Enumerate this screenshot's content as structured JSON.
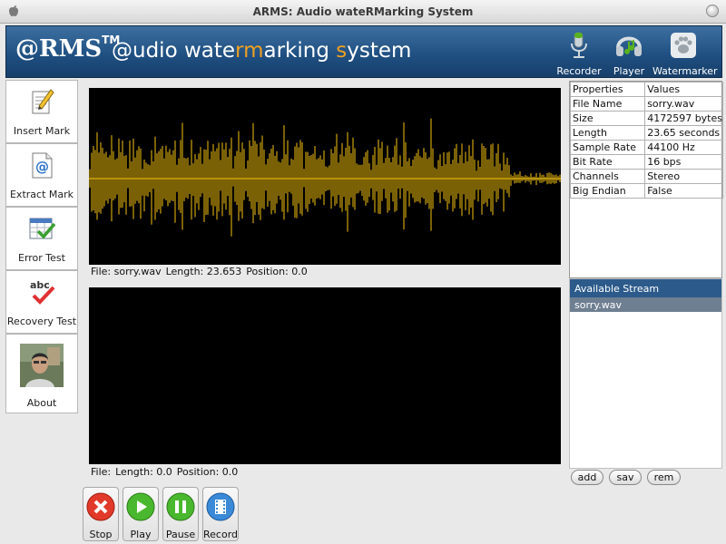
{
  "window": {
    "title": "ARMS: Audio wateRMarking System"
  },
  "header": {
    "logo": "@RMS",
    "logo_tm": "TM",
    "tagline_parts": [
      "@udio wate",
      "rm",
      "arking ",
      "s",
      "ystem"
    ],
    "buttons": {
      "recorder": "Recorder",
      "player": "Player",
      "watermarker": "Watermarker"
    }
  },
  "sidebar": {
    "items": [
      {
        "label": "Insert Mark"
      },
      {
        "label": "Extract Mark"
      },
      {
        "label": "Error Test"
      },
      {
        "label": "Recovery Test"
      },
      {
        "label": "About"
      }
    ]
  },
  "waveform1": {
    "file_label": "File: sorry.wav",
    "length_label": "Length: 23.653",
    "position_label": "Position: 0.0"
  },
  "waveform2": {
    "file_label": "File:",
    "length_label": "Length: 0.0",
    "position_label": "Position: 0.0"
  },
  "properties": {
    "header": [
      "Properties",
      "Values"
    ],
    "rows": [
      [
        "File Name",
        "sorry.wav"
      ],
      [
        "Size",
        "4172597 bytes"
      ],
      [
        "Length",
        "23.65 seconds"
      ],
      [
        "Sample Rate",
        "44100 Hz"
      ],
      [
        "Bit Rate",
        "16 bps"
      ],
      [
        "Channels",
        "Stereo"
      ],
      [
        "Big Endian",
        "False"
      ]
    ]
  },
  "stream": {
    "header": "Available Stream",
    "items": [
      "sorry.wav"
    ]
  },
  "stream_buttons": {
    "add": "add",
    "sav": "sav",
    "rem": "rem"
  },
  "transport": {
    "stop": "Stop",
    "play": "Play",
    "pause": "Pause",
    "record": "Record"
  },
  "colors": {
    "waveform": "#f4c20d",
    "header_bg": "#1e4e80",
    "tagline_accent": "#f0a020"
  }
}
